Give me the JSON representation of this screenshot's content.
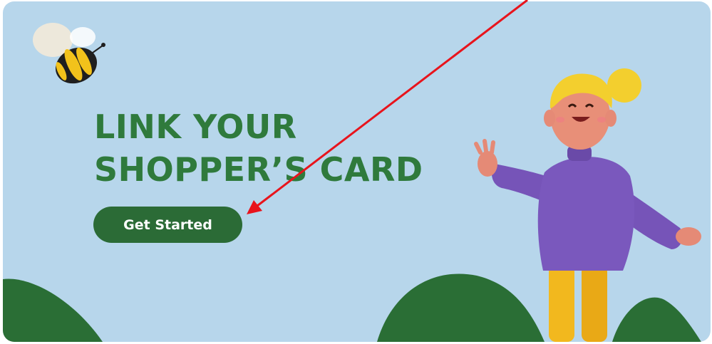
{
  "banner": {
    "headline_line1": "LINK YOUR",
    "headline_line2": "SHOPPER’S CARD",
    "cta_label": "Get Started"
  },
  "colors": {
    "background": "#b7d6eb",
    "headline": "#2f7a3c",
    "button": "#2b6b36",
    "button_text": "#ffffff",
    "hill": "#2a6e35",
    "annotation_arrow": "#e8141c"
  },
  "decorations": {
    "mascot": "bee-icon",
    "character": "waving-person-illustration",
    "annotation": "red-arrow-pointing-to-get-started"
  }
}
